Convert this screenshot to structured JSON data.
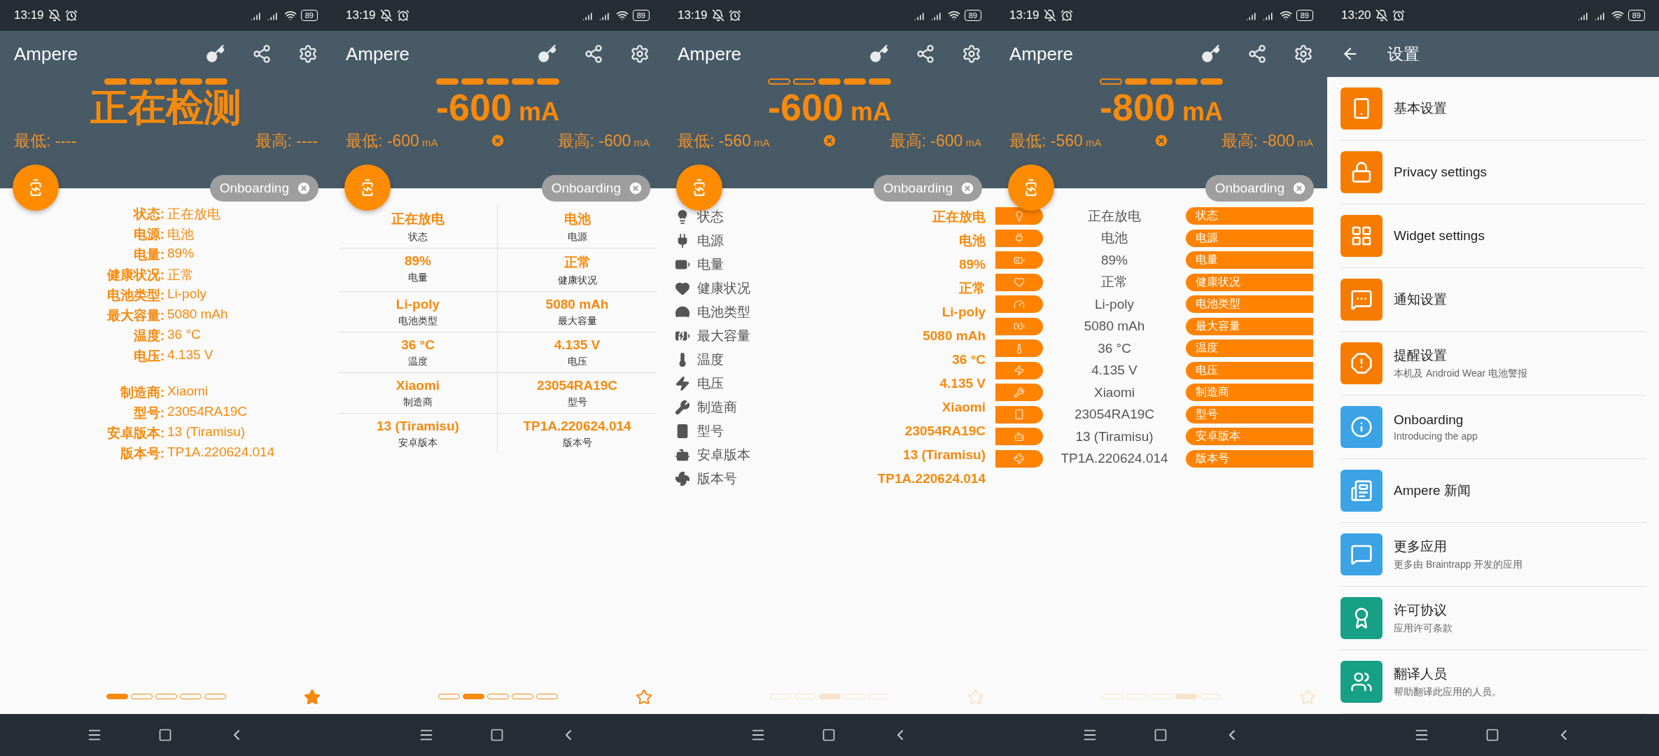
{
  "screens": [
    {
      "kind": "meter",
      "status_bar": {
        "time": "13:19",
        "battery": "89"
      },
      "app_bar": {
        "title": "Ampere"
      },
      "meter": {
        "segments": [
          {
            "filled": true
          },
          {
            "filled": true
          },
          {
            "filled": true
          },
          {
            "filled": true
          },
          {
            "filled": true
          }
        ],
        "value": "正在检测",
        "min": {
          "label": "最低:",
          "value": "----"
        },
        "max": {
          "label": "最高:",
          "value": "----"
        },
        "reset": false
      },
      "chip": {
        "label": "Onboarding"
      },
      "info": {
        "kind": "labeled_list",
        "groups": [
          [
            {
              "label": "状态:",
              "value": "正在放电"
            },
            {
              "label": "电源:",
              "value": "电池"
            },
            {
              "label": "电量:",
              "value": "89%"
            },
            {
              "label": "健康状况:",
              "value": "正常"
            },
            {
              "label": "电池类型:",
              "value": "Li-poly"
            },
            {
              "label": "最大容量:",
              "value": "5080 mAh"
            },
            {
              "label": "温度:",
              "value": "36 °C"
            },
            {
              "label": "电压:",
              "value": "4.135 V"
            }
          ],
          [
            {
              "label": "制造商:",
              "value": "Xiaomi"
            },
            {
              "label": "型号:",
              "value": "23054RA19C"
            },
            {
              "label": "安卓版本:",
              "value": "13 (Tiramisu)"
            },
            {
              "label": "版本号:",
              "value": "TP1A.220624.014"
            }
          ]
        ]
      },
      "pager": {
        "dimmed": false,
        "dots": [
          {
            "selected": true
          },
          {
            "selected": false
          },
          {
            "selected": false
          },
          {
            "selected": false
          },
          {
            "selected": false
          }
        ],
        "star": {
          "filled": true
        }
      }
    },
    {
      "kind": "meter",
      "status_bar": {
        "time": "13:19",
        "battery": "89"
      },
      "app_bar": {
        "title": "Ampere"
      },
      "meter": {
        "segments": [
          {
            "filled": true
          },
          {
            "filled": true
          },
          {
            "filled": true
          },
          {
            "filled": true
          },
          {
            "filled": true
          }
        ],
        "value": "-600",
        "unit": "mA",
        "min": {
          "label": "最低:",
          "value": "-600",
          "unit": "mA"
        },
        "max": {
          "label": "最高:",
          "value": "-600",
          "unit": "mA"
        },
        "reset": true
      },
      "chip": {
        "label": "Onboarding"
      },
      "info": {
        "kind": "grid",
        "rows": [
          {
            "value": "正在放电",
            "label": "状态"
          },
          {
            "value": "电池",
            "label": "电源"
          },
          {
            "value": "89%",
            "label": "电量"
          },
          {
            "value": "正常",
            "label": "健康状况"
          },
          {
            "value": "Li-poly",
            "label": "电池类型"
          },
          {
            "value": "5080 mAh",
            "label": "最大容量"
          },
          {
            "value": "36 °C",
            "label": "温度"
          },
          {
            "value": "4.135 V",
            "label": "电压"
          },
          {
            "value": "Xiaomi",
            "label": "制造商"
          },
          {
            "value": "23054RA19C",
            "label": "型号"
          },
          {
            "value": "13 (Tiramisu)",
            "label": "安卓版本"
          },
          {
            "value": "TP1A.220624.014",
            "label": "版本号"
          }
        ]
      },
      "pager": {
        "dimmed": false,
        "dots": [
          {
            "selected": false
          },
          {
            "selected": true
          },
          {
            "selected": false
          },
          {
            "selected": false
          },
          {
            "selected": false
          }
        ],
        "star": {
          "filled": false
        }
      }
    },
    {
      "kind": "meter",
      "status_bar": {
        "time": "13:19",
        "battery": "89"
      },
      "app_bar": {
        "title": "Ampere"
      },
      "meter": {
        "segments": [
          {
            "filled": false
          },
          {
            "filled": false
          },
          {
            "filled": true
          },
          {
            "filled": true
          },
          {
            "filled": true
          }
        ],
        "value": "-600",
        "unit": "mA",
        "min": {
          "label": "最低:",
          "value": "-560",
          "unit": "mA"
        },
        "max": {
          "label": "最高:",
          "value": "-600",
          "unit": "mA"
        },
        "reset": true
      },
      "chip": {
        "label": "Onboarding"
      },
      "info": {
        "kind": "icon_list",
        "rows": [
          {
            "label": "状态",
            "value": "正在放电"
          },
          {
            "label": "电源",
            "value": "电池"
          },
          {
            "label": "电量",
            "value": "89%"
          },
          {
            "label": "健康状况",
            "value": "正常"
          },
          {
            "label": "电池类型",
            "value": "Li-poly"
          },
          {
            "label": "最大容量",
            "value": "5080 mAh"
          },
          {
            "label": "温度",
            "value": "36 °C"
          },
          {
            "label": "电压",
            "value": "4.135 V"
          },
          {
            "label": "制造商",
            "value": "Xiaomi"
          },
          {
            "label": "型号",
            "value": "23054RA19C"
          },
          {
            "label": "安卓版本",
            "value": "13 (Tiramisu)"
          },
          {
            "label": "版本号",
            "value": "TP1A.220624.014"
          }
        ]
      },
      "pager": {
        "dimmed": true,
        "dots": [
          {
            "selected": false
          },
          {
            "selected": false
          },
          {
            "selected": true
          },
          {
            "selected": false
          },
          {
            "selected": false
          }
        ],
        "star": {
          "filled": false
        }
      }
    },
    {
      "kind": "meter",
      "status_bar": {
        "time": "13:19",
        "battery": "89"
      },
      "app_bar": {
        "title": "Ampere"
      },
      "meter": {
        "segments": [
          {
            "filled": false
          },
          {
            "filled": true
          },
          {
            "filled": true
          },
          {
            "filled": true
          },
          {
            "filled": true
          }
        ],
        "value": "-800",
        "unit": "mA",
        "min": {
          "label": "最低:",
          "value": "-560",
          "unit": "mA"
        },
        "max": {
          "label": "最高:",
          "value": "-800",
          "unit": "mA"
        },
        "reset": true
      },
      "chip": {
        "label": "Onboarding"
      },
      "info": {
        "kind": "pill_list",
        "rows": [
          {
            "value": "正在放电",
            "label": "状态"
          },
          {
            "value": "电池",
            "label": "电源"
          },
          {
            "value": "89%",
            "label": "电量"
          },
          {
            "value": "正常",
            "label": "健康状况"
          },
          {
            "value": "Li-poly",
            "label": "电池类型"
          },
          {
            "value": "5080 mAh",
            "label": "最大容量"
          },
          {
            "value": "36 °C",
            "label": "温度"
          },
          {
            "value": "4.135 V",
            "label": "电压"
          },
          {
            "value": "Xiaomi",
            "label": "制造商"
          },
          {
            "value": "23054RA19C",
            "label": "型号"
          },
          {
            "value": "13 (Tiramisu)",
            "label": "安卓版本"
          },
          {
            "value": "TP1A.220624.014",
            "label": "版本号"
          }
        ]
      },
      "pager": {
        "dimmed": true,
        "dots": [
          {
            "selected": false
          },
          {
            "selected": false
          },
          {
            "selected": false
          },
          {
            "selected": true
          },
          {
            "selected": false
          }
        ],
        "star": {
          "filled": false
        }
      }
    },
    {
      "kind": "settings",
      "status_bar": {
        "time": "13:20",
        "battery": "89"
      },
      "app_bar": {
        "title": "设置"
      },
      "items": [
        {
          "title": "基本设置",
          "color": "#f57c00"
        },
        {
          "title": "Privacy settings",
          "color": "#f57c00"
        },
        {
          "title": "Widget settings",
          "color": "#f57c00"
        },
        {
          "title": "通知设置",
          "color": "#f57c00"
        },
        {
          "title": "提醒设置",
          "subtitle": "本机及 Android Wear 电池警报",
          "color": "#f57c00"
        },
        {
          "title": "Onboarding",
          "subtitle": "Introducing the app",
          "color": "#3ba3e6"
        },
        {
          "title": "Ampere 新闻",
          "color": "#3ba3e6"
        },
        {
          "title": "更多应用",
          "subtitle": "更多由 Braintrapp 开发的应用",
          "color": "#3ba3e6"
        },
        {
          "title": "许可协议",
          "subtitle": "应用许可条款",
          "color": "#16a085"
        },
        {
          "title": "翻译人员",
          "subtitle": "帮助翻译此应用的人员。",
          "color": "#16a085"
        }
      ]
    }
  ]
}
